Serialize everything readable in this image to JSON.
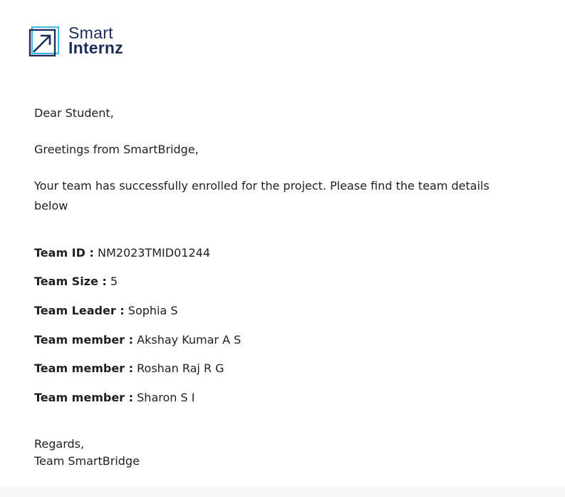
{
  "brand": {
    "line1": "Smart",
    "line2": "Internz",
    "icon": "smartinternz-logo-icon",
    "color": "#1d2d5a",
    "accent": "#3fb8e6"
  },
  "email": {
    "salutation": "Dear Student,",
    "greeting": "Greetings from SmartBridge,",
    "intro": "Your team has successfully enrolled for the project. Please find the team details below",
    "details": [
      {
        "label": "Team ID :",
        "value": "NM2023TMID01244"
      },
      {
        "label": "Team Size :",
        "value": "5"
      },
      {
        "label": "Team Leader :",
        "value": "Sophia S"
      },
      {
        "label": "Team member :",
        "value": "Akshay Kumar A S"
      },
      {
        "label": "Team member :",
        "value": "Roshan Raj R G"
      },
      {
        "label": "Team member :",
        "value": "Sharon S I"
      }
    ],
    "closing": "Regards,",
    "signature": "Team SmartBridge"
  }
}
